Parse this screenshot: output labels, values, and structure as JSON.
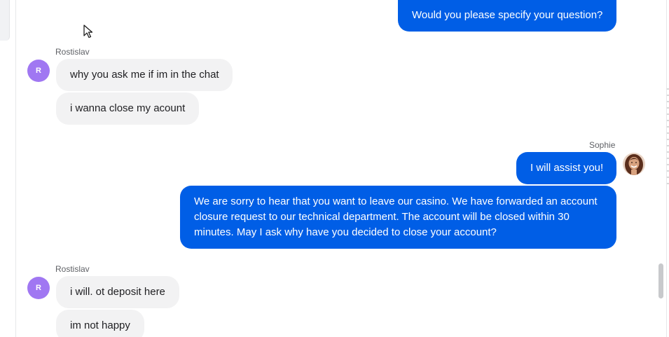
{
  "messages": [
    {
      "sender": "",
      "text": "Would you please specify your question?"
    },
    {
      "sender": "Rostislav",
      "avatar_initial": "R",
      "lines": [
        "why you ask me if im in the chat",
        "i wanna close my acount"
      ]
    },
    {
      "sender": "Sophie",
      "lines": [
        "I will assist you!",
        "We are sorry to hear that you want to leave our casino. We have forwarded an account",
        "closure request to our technical department. The account will be closed within 30",
        "minutes. May I ask why have you decided to close your account?"
      ]
    },
    {
      "sender": "Rostislav",
      "avatar_initial": "R",
      "lines": [
        "i will. ot deposit here",
        "im not happy"
      ]
    }
  ],
  "colors": {
    "outgoing_bubble": "#005ee6",
    "incoming_bubble": "#f2f2f3",
    "avatar_r": "#a077f2"
  }
}
